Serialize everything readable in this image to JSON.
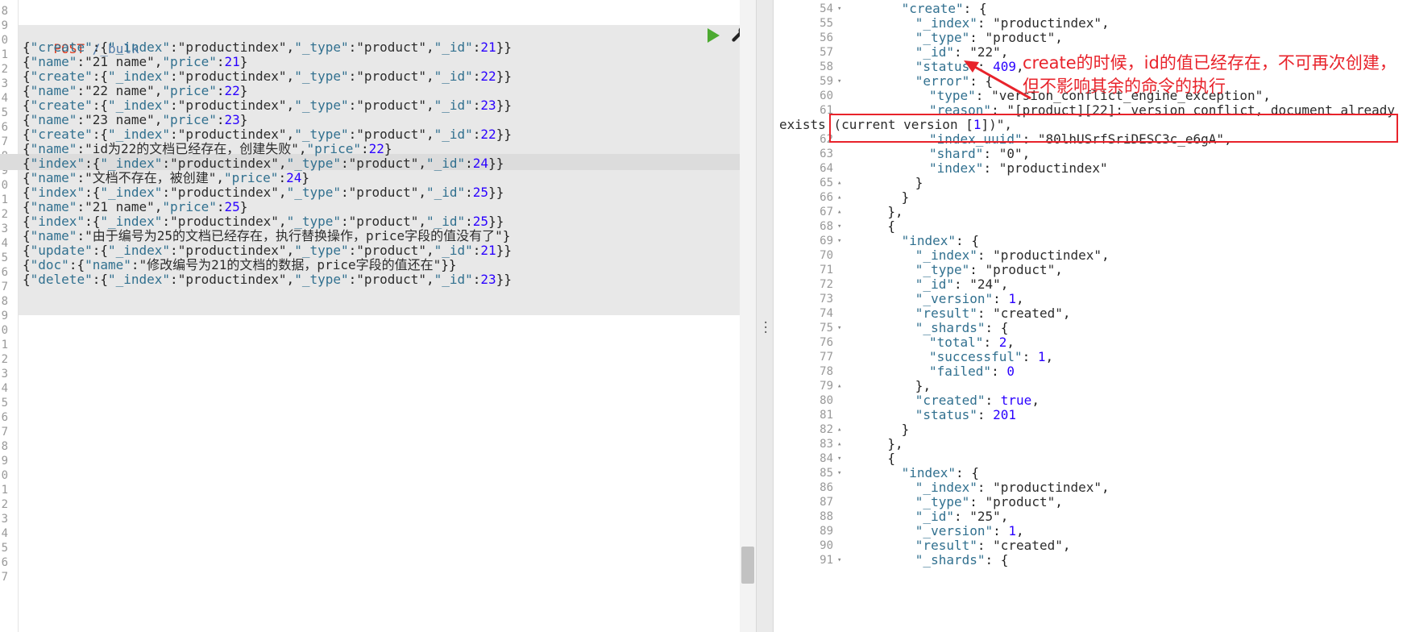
{
  "request_editor": {
    "line_numbers": [
      "8",
      "9",
      "0",
      "1",
      "2",
      "3",
      "4",
      "5",
      "6",
      "7",
      "8",
      "9",
      "0",
      "1",
      "2",
      "3",
      "4",
      "5",
      "6",
      "7",
      "8",
      "9",
      "0",
      "1",
      "2",
      "3",
      "4",
      "5",
      "6",
      "7",
      "8",
      "9",
      "0",
      "1",
      "2",
      "3",
      "4",
      "5",
      "6",
      "7"
    ],
    "method": "POST",
    "endpoint": "/_bulk",
    "lines": [
      "{\"create\":{\"_index\":\"productindex\",\"_type\":\"product\",\"_id\":21}}",
      "{\"name\":\"21 name\",\"price\":21}",
      "{\"create\":{\"_index\":\"productindex\",\"_type\":\"product\",\"_id\":22}}",
      "{\"name\":\"22 name\",\"price\":22}",
      "{\"create\":{\"_index\":\"productindex\",\"_type\":\"product\",\"_id\":23}}",
      "{\"name\":\"23 name\",\"price\":23}",
      "{\"create\":{\"_index\":\"productindex\",\"_type\":\"product\",\"_id\":22}}",
      "{\"name\":\"id为22的文档已经存在，创建失败\",\"price\":22}",
      "{\"index\":{\"_index\":\"productindex\",\"_type\":\"product\",\"_id\":24}}",
      "{\"name\":\"文档不存在，被创建\",\"price\":24}",
      "{\"index\":{\"_index\":\"productindex\",\"_type\":\"product\",\"_id\":25}}",
      "{\"name\":\"21 name\",\"price\":25}",
      "{\"index\":{\"_index\":\"productindex\",\"_type\":\"product\",\"_id\":25}}",
      "{\"name\":\"由于编号为25的文档已经存在，执行替换操作，price字段的值没有了\"}",
      "{\"update\":{\"_index\":\"productindex\",\"_type\":\"product\",\"_id\":21}}",
      "{\"doc\":{\"name\":\"修改编号为21的文档的数据，price字段的值还在\"}}",
      "{\"delete\":{\"_index\":\"productindex\",\"_type\":\"product\",\"_id\":23}}"
    ],
    "run_icon": "play-icon",
    "settings_icon": "wrench-icon"
  },
  "response_viewer": {
    "lines": [
      {
        "n": "54",
        "fold": "▾",
        "indent": 6,
        "text": "\"create\": {"
      },
      {
        "n": "55",
        "fold": "",
        "indent": 8,
        "text": "\"_index\": \"productindex\","
      },
      {
        "n": "56",
        "fold": "",
        "indent": 8,
        "text": "\"_type\": \"product\","
      },
      {
        "n": "57",
        "fold": "",
        "indent": 8,
        "text": "\"_id\": \"22\","
      },
      {
        "n": "58",
        "fold": "",
        "indent": 8,
        "text": "\"status\": 409,"
      },
      {
        "n": "59",
        "fold": "▾",
        "indent": 8,
        "text": "\"error\": {"
      },
      {
        "n": "60",
        "fold": "",
        "indent": 10,
        "text": "\"type\": \"version_conflict_engine_exception\","
      },
      {
        "n": "61",
        "fold": "",
        "indent": 10,
        "text": "\"reason\": \"[product][22]: version conflict, document already"
      },
      {
        "n": "",
        "fold": "",
        "indent": 0,
        "text": "exists (current version [1])\","
      },
      {
        "n": "62",
        "fold": "",
        "indent": 10,
        "text": "\"index_uuid\": \"80lhUSrfSriDESC3c_e6gA\","
      },
      {
        "n": "63",
        "fold": "",
        "indent": 10,
        "text": "\"shard\": \"0\","
      },
      {
        "n": "64",
        "fold": "",
        "indent": 10,
        "text": "\"index\": \"productindex\""
      },
      {
        "n": "65",
        "fold": "▴",
        "indent": 8,
        "text": "}"
      },
      {
        "n": "66",
        "fold": "▴",
        "indent": 6,
        "text": "}"
      },
      {
        "n": "67",
        "fold": "▴",
        "indent": 4,
        "text": "},"
      },
      {
        "n": "68",
        "fold": "▾",
        "indent": 4,
        "text": "{"
      },
      {
        "n": "69",
        "fold": "▾",
        "indent": 6,
        "text": "\"index\": {"
      },
      {
        "n": "70",
        "fold": "",
        "indent": 8,
        "text": "\"_index\": \"productindex\","
      },
      {
        "n": "71",
        "fold": "",
        "indent": 8,
        "text": "\"_type\": \"product\","
      },
      {
        "n": "72",
        "fold": "",
        "indent": 8,
        "text": "\"_id\": \"24\","
      },
      {
        "n": "73",
        "fold": "",
        "indent": 8,
        "text": "\"_version\": 1,"
      },
      {
        "n": "74",
        "fold": "",
        "indent": 8,
        "text": "\"result\": \"created\","
      },
      {
        "n": "75",
        "fold": "▾",
        "indent": 8,
        "text": "\"_shards\": {"
      },
      {
        "n": "76",
        "fold": "",
        "indent": 10,
        "text": "\"total\": 2,"
      },
      {
        "n": "77",
        "fold": "",
        "indent": 10,
        "text": "\"successful\": 1,"
      },
      {
        "n": "78",
        "fold": "",
        "indent": 10,
        "text": "\"failed\": 0"
      },
      {
        "n": "79",
        "fold": "▴",
        "indent": 8,
        "text": "},"
      },
      {
        "n": "80",
        "fold": "",
        "indent": 8,
        "text": "\"created\": true,"
      },
      {
        "n": "81",
        "fold": "",
        "indent": 8,
        "text": "\"status\": 201"
      },
      {
        "n": "82",
        "fold": "▴",
        "indent": 6,
        "text": "}"
      },
      {
        "n": "83",
        "fold": "▴",
        "indent": 4,
        "text": "},"
      },
      {
        "n": "84",
        "fold": "▾",
        "indent": 4,
        "text": "{"
      },
      {
        "n": "85",
        "fold": "▾",
        "indent": 6,
        "text": "\"index\": {"
      },
      {
        "n": "86",
        "fold": "",
        "indent": 8,
        "text": "\"_index\": \"productindex\","
      },
      {
        "n": "87",
        "fold": "",
        "indent": 8,
        "text": "\"_type\": \"product\","
      },
      {
        "n": "88",
        "fold": "",
        "indent": 8,
        "text": "\"_id\": \"25\","
      },
      {
        "n": "89",
        "fold": "",
        "indent": 8,
        "text": "\"_version\": 1,"
      },
      {
        "n": "90",
        "fold": "",
        "indent": 8,
        "text": "\"result\": \"created\","
      },
      {
        "n": "91",
        "fold": "▾",
        "indent": 8,
        "text": "\"_shards\": {"
      }
    ]
  },
  "annotation": {
    "text": "create的时候，id的值已经存在，不可再次创建，但不影响其余的命令的执行",
    "color": "#e8232b"
  },
  "colors": {
    "key": "#31708f",
    "number": "#2a00ff",
    "method": "#e2391b",
    "run": "#4caa31"
  }
}
